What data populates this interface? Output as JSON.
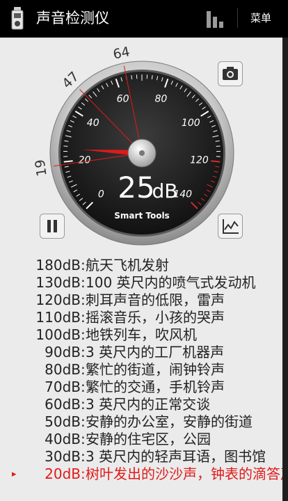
{
  "app": {
    "title": "声音检测仪",
    "menu_label": "菜单"
  },
  "gauge": {
    "reading_value": "25",
    "reading_unit": "dB",
    "brand": "Smart Tools",
    "dial_labels": [
      "0",
      "20",
      "40",
      "60",
      "80",
      "100",
      "120",
      "140"
    ],
    "outer_markers": [
      "19",
      "47",
      "64"
    ],
    "needle_db": 25,
    "accent": "#d62a2a"
  },
  "icons": [
    "sound-meter-app-icon",
    "bar-chart-icon",
    "camera-icon",
    "pause-icon",
    "graph-icon"
  ],
  "scale": [
    {
      "db": "180dB",
      "colon": ":",
      "desc": "航天飞机发射"
    },
    {
      "db": "130dB",
      "colon": ":",
      "desc": "100 英尺内的喷气式发动机"
    },
    {
      "db": "120dB",
      "colon": ":",
      "desc": "刺耳声音的低限，雷声"
    },
    {
      "db": "110dB",
      "colon": ":",
      "desc": "摇滚音乐，小孩的哭声"
    },
    {
      "db": "100dB",
      "colon": ":",
      "desc": "地铁列车，吹风机"
    },
    {
      "db": "90dB",
      "colon": ":",
      "desc": "3 英尺内的工厂机器声"
    },
    {
      "db": "80dB",
      "colon": ":",
      "desc": "繁忙的街道，闹钟铃声"
    },
    {
      "db": "70dB",
      "colon": ":",
      "desc": "繁忙的交通，手机铃声"
    },
    {
      "db": "60dB",
      "colon": ":",
      "desc": "3 英尺内的正常交谈"
    },
    {
      "db": "50dB",
      "colon": ":",
      "desc": "安静的办公室，安静的街道"
    },
    {
      "db": "40dB",
      "colon": ":",
      "desc": "安静的住宅区，公园"
    },
    {
      "db": "30dB",
      "colon": ":",
      "desc": "3 英尺内的轻声耳语，图书馆"
    },
    {
      "db": "20dB",
      "colon": ":",
      "desc": "树叶发出的沙沙声，钟表的滴答声",
      "current": true,
      "marker": "▸"
    }
  ]
}
